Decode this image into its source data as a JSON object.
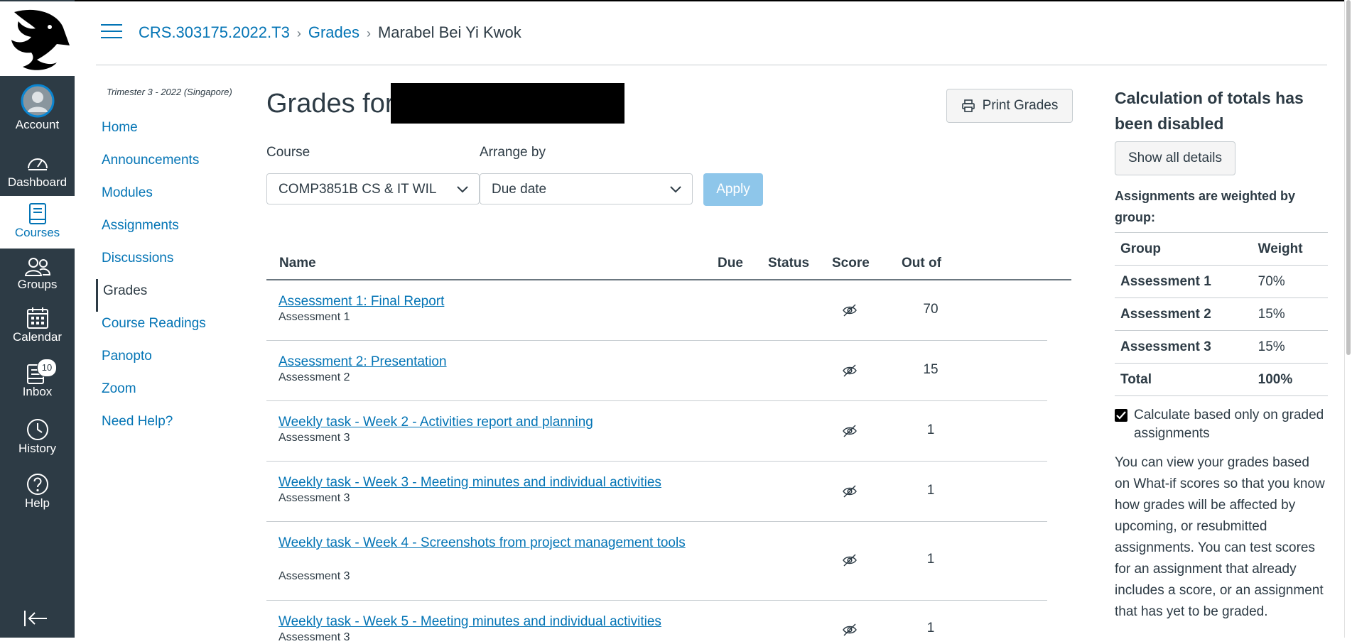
{
  "global_nav": {
    "items": [
      {
        "key": "account",
        "label": "Account",
        "icon": "avatar-icon"
      },
      {
        "key": "dashboard",
        "label": "Dashboard",
        "icon": "speedometer-icon"
      },
      {
        "key": "courses",
        "label": "Courses",
        "icon": "book-icon",
        "active": true
      },
      {
        "key": "groups",
        "label": "Groups",
        "icon": "groups-icon"
      },
      {
        "key": "calendar",
        "label": "Calendar",
        "icon": "calendar-icon"
      },
      {
        "key": "inbox",
        "label": "Inbox",
        "icon": "inbox-icon",
        "badge": "10"
      },
      {
        "key": "history",
        "label": "History",
        "icon": "clock-icon"
      },
      {
        "key": "help",
        "label": "Help",
        "icon": "question-icon"
      }
    ]
  },
  "breadcrumb": {
    "course": "CRS.303175.2022.T3",
    "section": "Grades",
    "current": "Marabel Bei Yi Kwok"
  },
  "course_nav": {
    "term": "Trimester 3 - 2022 (Singapore)",
    "items": [
      "Home",
      "Announcements",
      "Modules",
      "Assignments",
      "Discussions",
      "Grades",
      "Course Readings",
      "Panopto",
      "Zoom",
      "Need Help?"
    ],
    "active": "Grades"
  },
  "main": {
    "title": "Grades for",
    "print_label": "Print Grades",
    "course_label": "Course",
    "course_value": "COMP3851B CS & IT WIL",
    "arrange_label": "Arrange by",
    "arrange_value": "Due date",
    "apply_label": "Apply"
  },
  "table": {
    "headers": {
      "name": "Name",
      "due": "Due",
      "status": "Status",
      "score": "Score",
      "out_of": "Out of"
    },
    "rows": [
      {
        "name": "Assessment 1: Final Report",
        "group": "Assessment 1",
        "out_of": "70"
      },
      {
        "name": "Assessment 2: Presentation",
        "group": "Assessment 2",
        "out_of": "15"
      },
      {
        "name": "Weekly task - Week 2 - Activities report and planning",
        "group": "Assessment 3",
        "out_of": "1"
      },
      {
        "name": "Weekly task - Week 3 - Meeting minutes and individual activities",
        "group": "Assessment 3",
        "out_of": "1"
      },
      {
        "name": "Weekly task - Week 4 - Screenshots from project management tools",
        "group": "Assessment 3",
        "out_of": "1"
      },
      {
        "name": "Weekly task - Week 5 - Meeting minutes and individual activities",
        "group": "Assessment 3",
        "out_of": "1"
      }
    ]
  },
  "sidebar": {
    "title": "Calculation of totals has been disabled",
    "show_details": "Show all details",
    "weighted_label": "Assignments are weighted by group:",
    "weights_header": {
      "group": "Group",
      "weight": "Weight"
    },
    "weights": [
      {
        "group": "Assessment 1",
        "weight": "70%"
      },
      {
        "group": "Assessment 2",
        "weight": "15%"
      },
      {
        "group": "Assessment 3",
        "weight": "15%"
      }
    ],
    "total": {
      "label": "Total",
      "weight": "100%"
    },
    "calc_checkbox": "Calculate based only on graded assignments",
    "whatif_text": "You can view your grades based on What-if scores so that you know how grades will be affected by upcoming, or resubmitted assignments. You can test scores for an assignment that already includes a score, or an assignment that has yet to be graded."
  },
  "colors": {
    "nav_bg": "#2d3b45",
    "link": "#0374b5",
    "apply_bg": "#8ec6ea"
  }
}
